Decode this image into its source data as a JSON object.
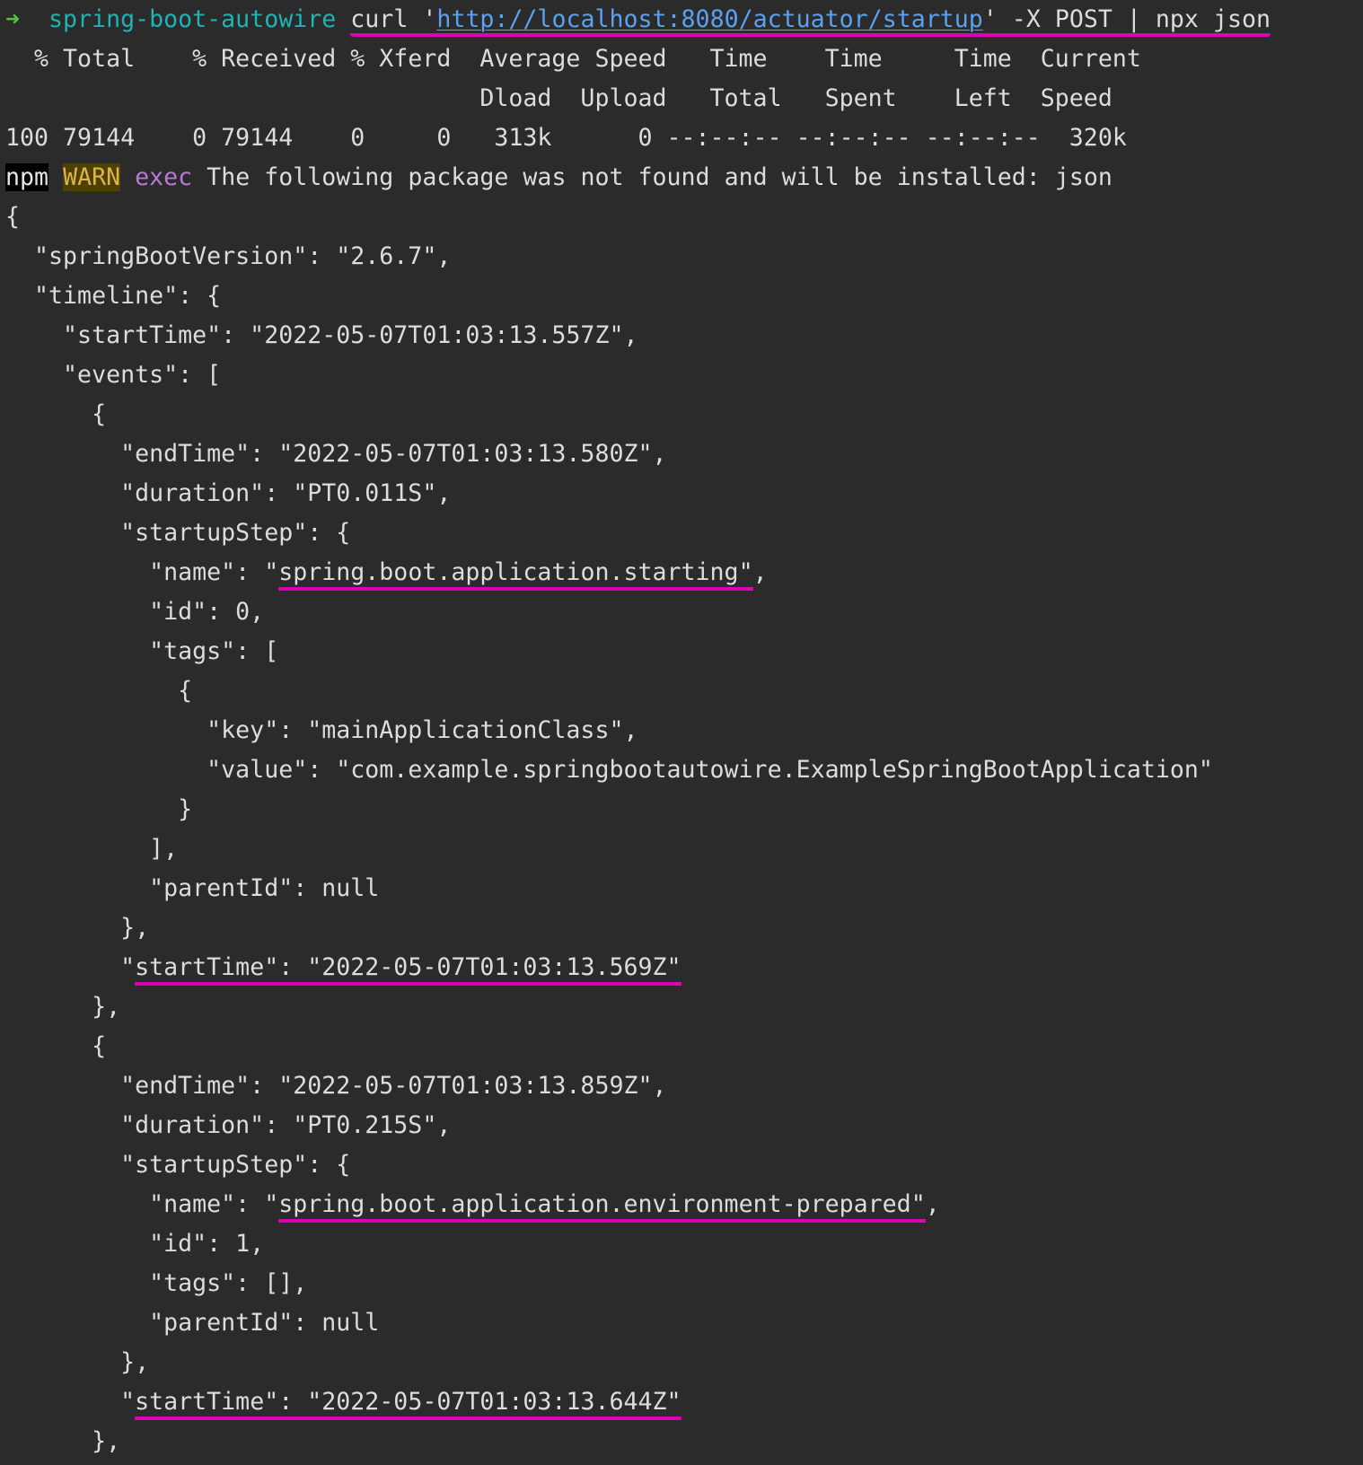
{
  "terminal": {
    "prompt": {
      "arrow": "➜",
      "directory": "spring-boot-autowire",
      "cmd_pre": "curl '",
      "url": "http://localhost:8080/actuator/startup",
      "cmd_post": "' -X POST | npx json"
    },
    "curl_progress": {
      "header1": "  % Total    % Received % Xferd  Average Speed   Time    Time     Time  Current",
      "header2": "                                 Dload  Upload   Total   Spent    Left  Speed",
      "row": "100 79144    0 79144    0     0   313k      0 --:--:-- --:--:-- --:--:--  320k"
    },
    "npm_warning": {
      "npm": "npm",
      "warn": "WARN",
      "exec": "exec",
      "message": " The following package was not found and will be installed: json"
    },
    "json_output": {
      "l01": "{",
      "l02": "  \"springBootVersion\": \"2.6.7\",",
      "l03": "  \"timeline\": {",
      "l04": "    \"startTime\": \"2022-05-07T01:03:13.557Z\",",
      "l05": "    \"events\": [",
      "l06": "      {",
      "l07": "        \"endTime\": \"2022-05-07T01:03:13.580Z\",",
      "l08": "        \"duration\": \"PT0.011S\",",
      "l09": "        \"startupStep\": {",
      "l10_pre": "          \"name\": \"",
      "l10_hl": "spring.boot.application.starting\"",
      "l10_post": ",",
      "l11": "          \"id\": 0,",
      "l12": "          \"tags\": [",
      "l13": "            {",
      "l14": "              \"key\": \"mainApplicationClass\",",
      "l15": "              \"value\": \"com.example.springbootautowire.ExampleSpringBootApplication\"",
      "l16": "            }",
      "l17": "          ],",
      "l18": "          \"parentId\": null",
      "l19": "        },",
      "l20_pre": "        \"",
      "l20_hl": "startTime\": \"2022-05-07T01:03:13.569Z\"",
      "l21": "      },",
      "l22": "      {",
      "l23": "        \"endTime\": \"2022-05-07T01:03:13.859Z\",",
      "l24": "        \"duration\": \"PT0.215S\",",
      "l25": "        \"startupStep\": {",
      "l26_pre": "          \"name\": \"",
      "l26_hl": "spring.boot.application.environment-prepared\"",
      "l26_post": ",",
      "l27": "          \"id\": 1,",
      "l28": "          \"tags\": [],",
      "l29": "          \"parentId\": null",
      "l30": "        },",
      "l31_pre": "        \"",
      "l31_hl": "startTime\": \"2022-05-07T01:03:13.644Z\"",
      "l32": "      },"
    }
  },
  "colors": {
    "background": "#2b2b2b",
    "text": "#dcdcdc",
    "prompt_arrow": "#56c23d",
    "directory": "#1fb3b3",
    "url": "#5aa1f2",
    "exec": "#b978d6",
    "warn_bg": "#4d4000",
    "warn_text": "#d9b44a",
    "highlight_underline": "#e000b4"
  }
}
